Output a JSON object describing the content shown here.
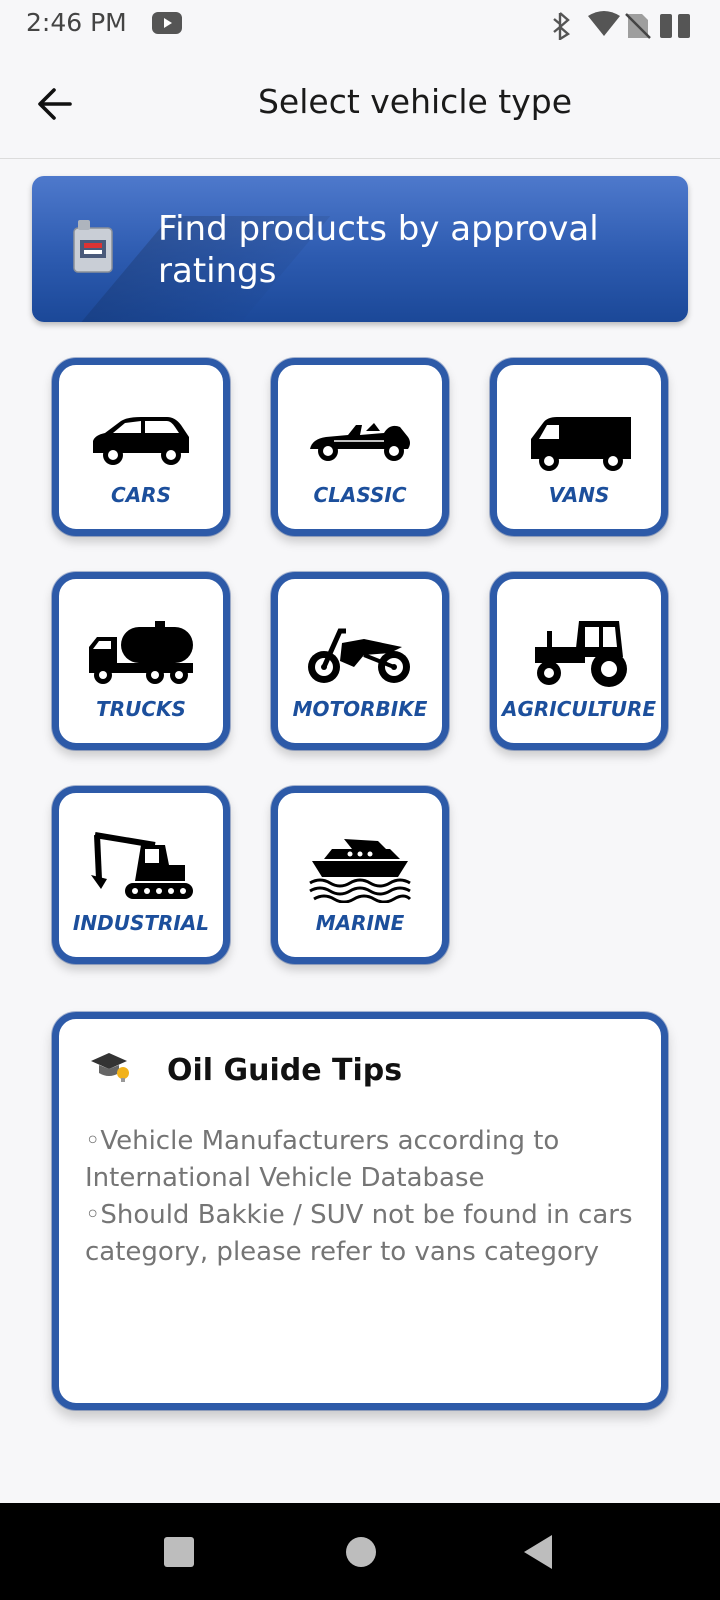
{
  "status_bar": {
    "time": "2:46 PM",
    "icons": [
      "youtube-icon",
      "bluetooth-icon",
      "wifi-icon",
      "no-sim-icon",
      "battery-icon"
    ]
  },
  "app_bar": {
    "back_icon": "arrow-left-icon",
    "title": "Select vehicle type"
  },
  "banner": {
    "icon": "oil-can-icon",
    "label": "Find products by approval ratings"
  },
  "vehicle_types": [
    {
      "label": "CARS",
      "icon": "car-icon"
    },
    {
      "label": "CLASSIC",
      "icon": "classic-car-icon"
    },
    {
      "label": "VANS",
      "icon": "van-icon"
    },
    {
      "label": "TRUCKS",
      "icon": "tanker-truck-icon"
    },
    {
      "label": "MOTORBIKE",
      "icon": "motorbike-icon"
    },
    {
      "label": "AGRICULTURE",
      "icon": "tractor-icon"
    },
    {
      "label": "INDUSTRIAL",
      "icon": "excavator-icon"
    },
    {
      "label": "MARINE",
      "icon": "boat-icon"
    }
  ],
  "tips": {
    "icon": "graduation-cap-bulb-icon",
    "title": "Oil Guide Tips",
    "lines": [
      "◦Vehicle Manufacturers according to International Vehicle Database",
      "◦Should Bakkie / SUV not be found in cars category, please refer to vans category"
    ]
  },
  "nav_bar": {
    "icons": [
      "recents-icon",
      "home-icon",
      "back-triangle-icon"
    ]
  },
  "colors": {
    "accent_blue": "#2d5aa8",
    "label_blue": "#1c4f9c",
    "banner_top": "#4e79cc",
    "banner_bottom": "#1b4898"
  }
}
